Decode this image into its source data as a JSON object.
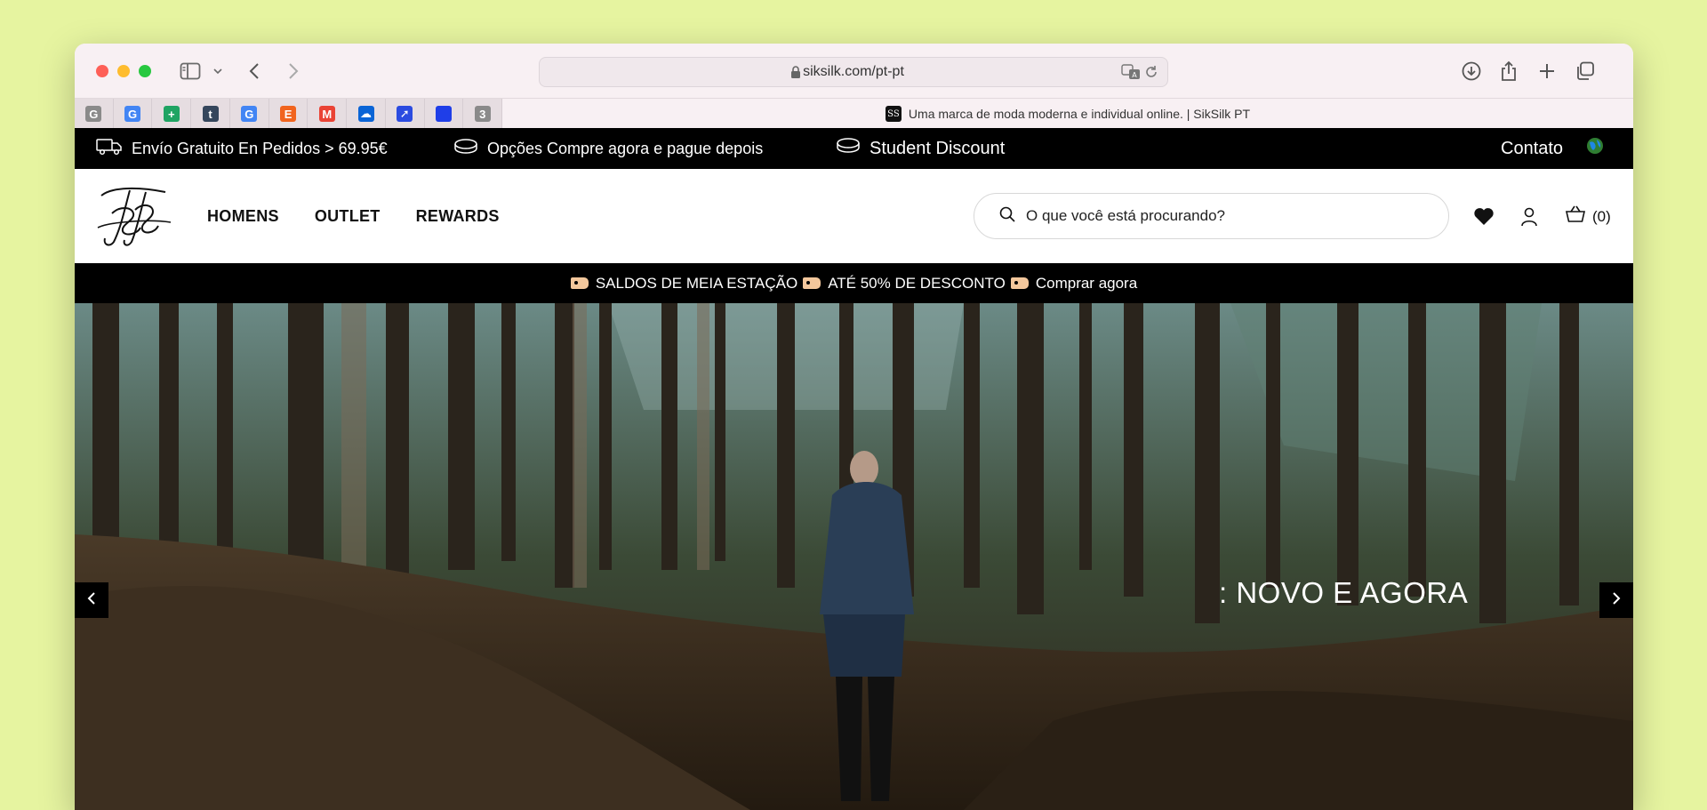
{
  "browser": {
    "url": "siksilk.com/pt-pt",
    "active_tab_title": "Uma marca de moda moderna e individual online. | SikSilk PT",
    "pinned_tabs": [
      {
        "icon": "google-grey-icon",
        "glyph": "G",
        "color": "#8a8a8a"
      },
      {
        "icon": "google-icon",
        "glyph": "G",
        "color": "#4285f4"
      },
      {
        "icon": "google-sheets-icon",
        "glyph": "+",
        "color": "#1fa463"
      },
      {
        "icon": "tumblr-icon",
        "glyph": "t",
        "color": "#35465c"
      },
      {
        "icon": "google-icon",
        "glyph": "G",
        "color": "#4285f4"
      },
      {
        "icon": "etsy-icon",
        "glyph": "E",
        "color": "#f1641e"
      },
      {
        "icon": "gmail-icon",
        "glyph": "M",
        "color": "#ea4335"
      },
      {
        "icon": "onedrive-icon",
        "glyph": "☁",
        "color": "#0a64d6"
      },
      {
        "icon": "blue-arrow-icon",
        "glyph": "➚",
        "color": "#2b4be0"
      },
      {
        "icon": "blue-square-icon",
        "glyph": "",
        "color": "#1f3ee8"
      },
      {
        "icon": "counter-badge-icon",
        "glyph": "3",
        "color": "#8a8a8a"
      }
    ]
  },
  "promo": {
    "shipping": "Envío Gratuito En Pedidos > 69.95€",
    "buy_now": "Opções Compre agora e pague depois",
    "student": "Student Discount",
    "contact": "Contato"
  },
  "nav": {
    "links": [
      "HOMENS",
      "OUTLET",
      "REWARDS"
    ],
    "search_placeholder": "O que você está procurando?",
    "cart_count": "(0)"
  },
  "sale": {
    "part1": "SALDOS DE MEIA ESTAÇÃO",
    "part2": "ATÉ 50% DE DESCONTO",
    "part3": "Comprar agora"
  },
  "hero": {
    "title": ": NOVO E AGORA"
  },
  "colors": {
    "background": "#e6f4a0",
    "promo_bar": "#000000",
    "accent_tag": "#f3c79c"
  }
}
